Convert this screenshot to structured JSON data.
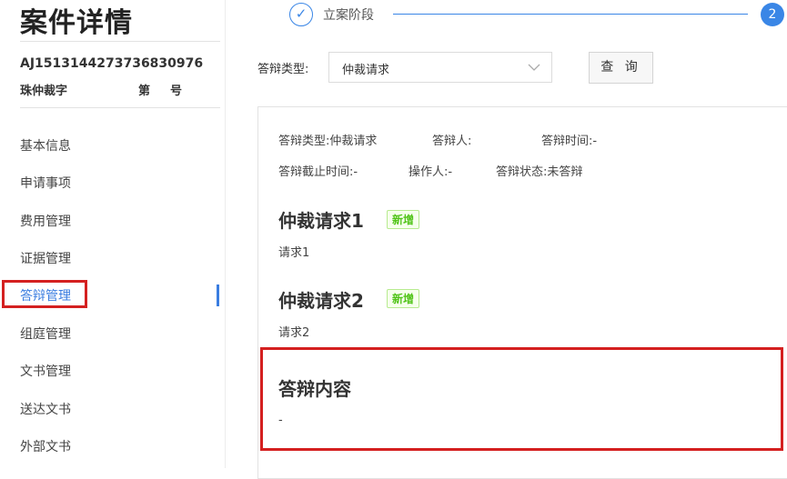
{
  "header": {
    "title": "案件详情"
  },
  "case": {
    "number": "AJ1513144273736830976",
    "code": "珠仲裁字",
    "label_di": "第",
    "label_hao": "号"
  },
  "sidebar": {
    "items": [
      {
        "label": "基本信息"
      },
      {
        "label": "申请事项"
      },
      {
        "label": "费用管理"
      },
      {
        "label": "证据管理"
      },
      {
        "label": "答辩管理",
        "active": true
      },
      {
        "label": "组庭管理"
      },
      {
        "label": "文书管理"
      },
      {
        "label": "送达文书"
      },
      {
        "label": "外部文书"
      }
    ]
  },
  "steps": {
    "step1": {
      "icon": "check-icon",
      "label": "立案阶段"
    },
    "step2": {
      "number": "2"
    }
  },
  "filter": {
    "label": "答辩类型:",
    "selected": "仲裁请求",
    "button_label": "查 询"
  },
  "defense": {
    "type_label": "答辩类型:",
    "type_value": "仲裁请求",
    "person_label": "答辩人:",
    "person_value": "",
    "time_label": "答辩时间:",
    "time_value": "-",
    "deadline_label": "答辩截止时间:",
    "deadline_value": "-",
    "operator_label": "操作人:",
    "operator_value": "-",
    "status_label": "答辩状态:",
    "status_value": "未答辩",
    "claims": [
      {
        "title": "仲裁请求1",
        "badge": "新增",
        "body": "请求1"
      },
      {
        "title": "仲裁请求2",
        "badge": "新增",
        "body": "请求2"
      }
    ],
    "content": {
      "title": "答辩内容",
      "body": "-"
    }
  },
  "colors": {
    "accent": "#3a86e6",
    "highlight": "#d42020",
    "badge_green": "#52c41a"
  }
}
